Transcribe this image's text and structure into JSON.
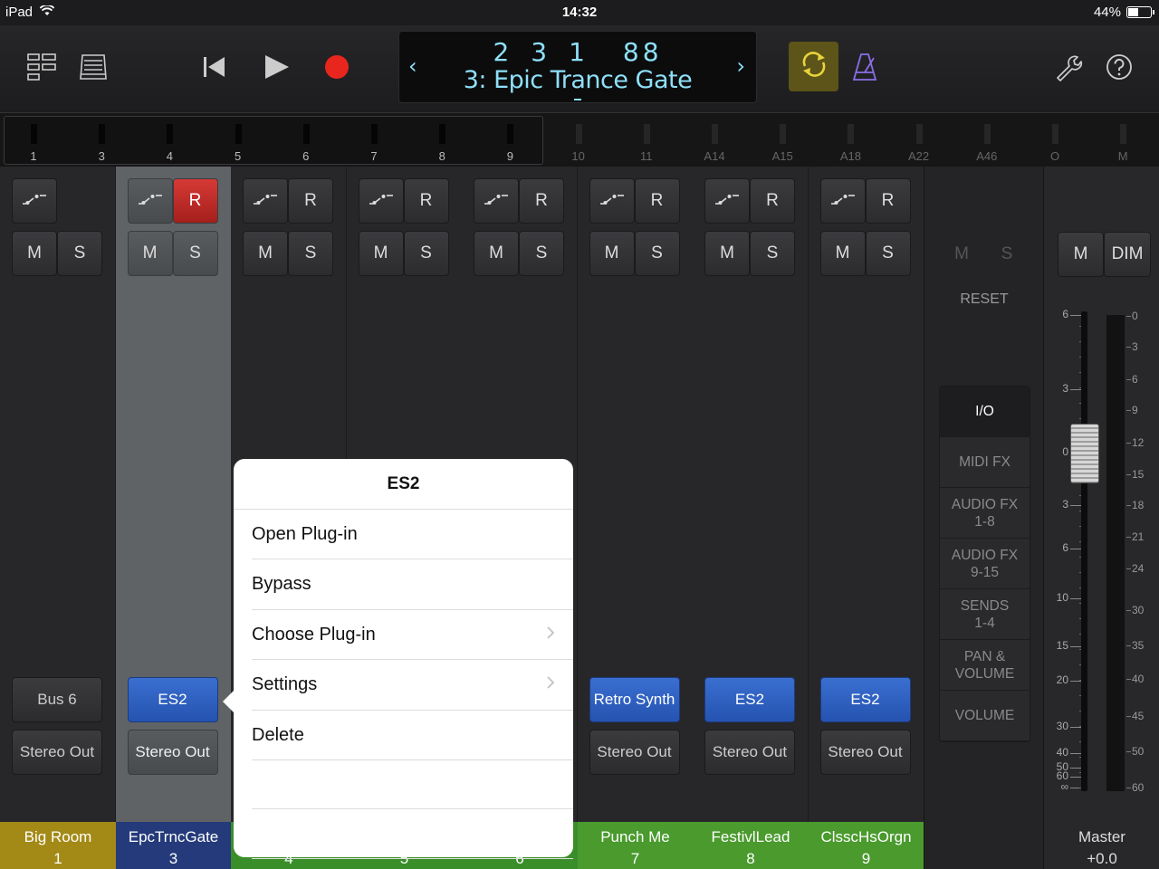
{
  "status_bar": {
    "device": "iPad",
    "time": "14:32",
    "battery": "44%",
    "battery_level": 0.44
  },
  "toolbar": {
    "position": [
      "2",
      "3",
      "1",
      "88"
    ],
    "song_title": "3: Epic Trance Gate",
    "prev_arrow": "‹",
    "next_arrow": "›",
    "cycle_active": true,
    "colors": {
      "lcd_text": "#8ee0f8",
      "record": "#e8261e",
      "cycle_bg": "#5c5418",
      "cycle_icon": "#e8d43a",
      "metronome": "#8a6ee8"
    }
  },
  "overview": {
    "items": [
      "1",
      "3",
      "4",
      "5",
      "6",
      "7",
      "8",
      "9",
      "10",
      "11",
      "A14",
      "A15",
      "A18",
      "A22",
      "A46",
      "O",
      "M"
    ]
  },
  "channels": [
    {
      "id": "ch1",
      "rec": false,
      "record_label": "",
      "mute": "M",
      "solo": "S",
      "slot_label": "Bus 6",
      "slot_plugin": false,
      "output": "Stereo Out",
      "name": "Big Room",
      "number": "1",
      "color": "#a38a17",
      "selected": false
    },
    {
      "id": "ch2",
      "rec": true,
      "record_label": "R",
      "mute": "M",
      "solo": "S",
      "slot_label": "ES2",
      "slot_plugin": true,
      "output": "Stereo Out",
      "name": "EpcTrncGate",
      "number": "3",
      "color": "#243a7a",
      "selected": true
    },
    {
      "id": "ch3",
      "rec": false,
      "record_label": "R",
      "mute": "M",
      "solo": "S",
      "slot_label": "",
      "slot_plugin": false,
      "output": "",
      "name": "",
      "number": "4",
      "color": "#3a8e2a",
      "selected": false
    },
    {
      "id": "ch4",
      "rec": false,
      "record_label": "R",
      "mute": "M",
      "solo": "S",
      "slot_label": "",
      "slot_plugin": false,
      "output": "",
      "name": "",
      "number": "5",
      "color": "#3a8e2a",
      "selected": false
    },
    {
      "id": "ch5",
      "rec": false,
      "record_label": "R",
      "mute": "M",
      "solo": "S",
      "slot_label": "",
      "slot_plugin": false,
      "output": "",
      "name": "",
      "number": "6",
      "color": "#3a8e2a",
      "selected": false
    },
    {
      "id": "ch6",
      "rec": false,
      "record_label": "R",
      "mute": "M",
      "solo": "S",
      "slot_label": "Retro Synth",
      "slot_plugin": true,
      "output": "Stereo Out",
      "name": "Punch Me",
      "number": "7",
      "color": "#4a9a2d",
      "selected": false
    },
    {
      "id": "ch7",
      "rec": false,
      "record_label": "R",
      "mute": "M",
      "solo": "S",
      "slot_label": "ES2",
      "slot_plugin": true,
      "output": "Stereo Out",
      "name": "FestivlLead",
      "number": "8",
      "color": "#4a9a2d",
      "selected": false
    },
    {
      "id": "ch8",
      "rec": false,
      "record_label": "R",
      "mute": "M",
      "solo": "S",
      "slot_label": "ES2",
      "slot_plugin": true,
      "output": "Stereo Out",
      "name": "ClsscHsOrgn",
      "number": "9",
      "color": "#4a9a2d",
      "selected": false
    }
  ],
  "side_panel": {
    "mute": "M",
    "solo": "S",
    "reset": "RESET",
    "tabs": [
      "I/O",
      "MIDI FX",
      "AUDIO FX\n1-8",
      "AUDIO FX\n9-15",
      "SENDS\n1-4",
      "PAN &\nVOLUME",
      "VOLUME"
    ],
    "active_tab": "I/O"
  },
  "master": {
    "mute": "M",
    "dim": "DIM",
    "name": "Master",
    "value": "+0.0",
    "fader_scale": [
      "6",
      "3",
      "0",
      "3",
      "6",
      "10",
      "15",
      "20",
      "30",
      "40",
      "50",
      "60",
      "∞"
    ],
    "meter_scale": [
      "0",
      "3",
      "6",
      "9",
      "12",
      "15",
      "18",
      "21",
      "24",
      "30",
      "35",
      "40",
      "45",
      "50",
      "60"
    ]
  },
  "popover": {
    "title": "ES2",
    "items": [
      {
        "label": "Open Plug-in",
        "chevron": false
      },
      {
        "label": "Bypass",
        "chevron": false
      },
      {
        "label": "Choose Plug-in",
        "chevron": true
      },
      {
        "label": "Settings",
        "chevron": true
      },
      {
        "label": "Delete",
        "chevron": false
      }
    ]
  }
}
